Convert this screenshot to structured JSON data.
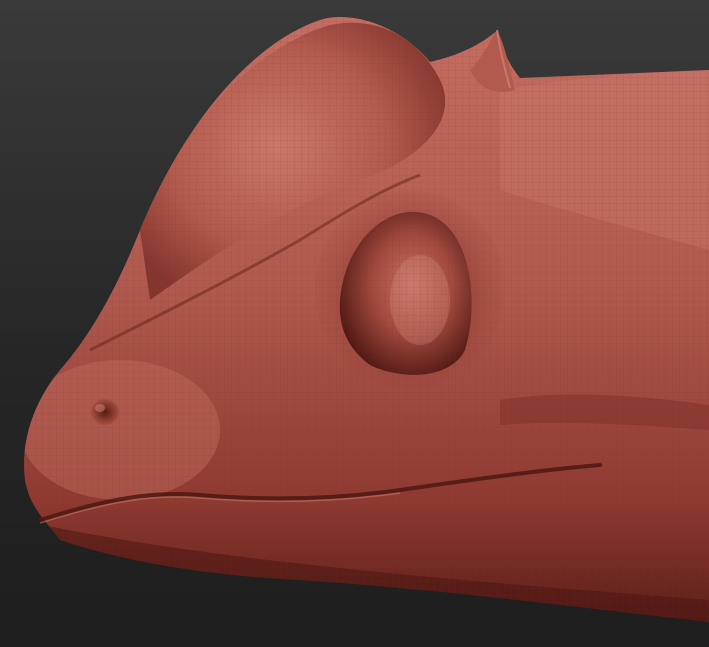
{
  "scene": {
    "subject": "sculpted-reptile-head",
    "colors": {
      "background_top": "#3a3a3a",
      "background_bottom": "#1e1e1e",
      "clay_base": "#a84a40",
      "clay_highlight": "#c9776b",
      "clay_shadow": "#5a1c17",
      "wire_line": "#7a2e27"
    }
  }
}
